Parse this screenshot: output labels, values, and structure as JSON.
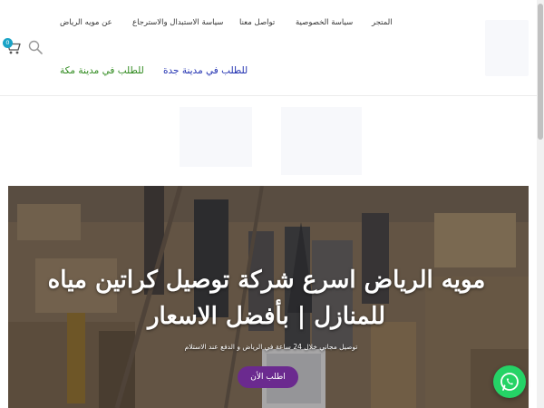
{
  "nav": {
    "items": [
      {
        "label": "المتجر"
      },
      {
        "label": "سياسة الخصوصية"
      },
      {
        "label": "تواصل معنا"
      },
      {
        "label": "سياسة الاستبدال والاسترجاع"
      },
      {
        "label": "عن مويه الرياض"
      }
    ],
    "city_links": [
      {
        "label": "للطلب في مدينة جدة",
        "color": "#1f2fb0"
      },
      {
        "label": "للطلب في مدينة مكة",
        "color": "#2f8a1e"
      }
    ]
  },
  "cart": {
    "count": "0",
    "badge_color": "#1aa3c6"
  },
  "hero": {
    "title": "مويه الرياض اسرع شركة توصيل كراتين مياه للمنازل | بأفضل الاسعار",
    "subtitle": "توصيل مجاني خلال 24 ساعة في الرياض و الدفع عند الاستلام",
    "button_label": "اطلب الأن",
    "button_color": "#6b2a8f"
  },
  "whatsapp": {
    "color": "#25d366"
  },
  "icons": [
    "search-icon",
    "cart-icon",
    "whatsapp-icon"
  ]
}
